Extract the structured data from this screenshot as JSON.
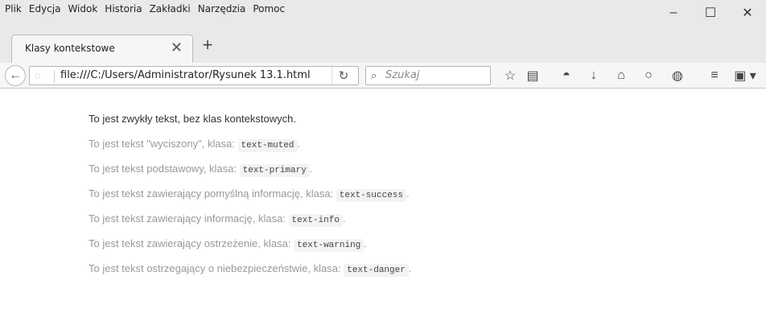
{
  "menu": [
    "Plik",
    "Edycja",
    "Widok",
    "Historia",
    "Zakładki",
    "Narzędzia",
    "Pomoc"
  ],
  "window_controls": {
    "minimize": "–",
    "maximize": "☐",
    "close": "✕"
  },
  "tab": {
    "title": "Klasy kontekstowe",
    "close": "✕"
  },
  "new_tab": "+",
  "url": "file:///C:/Users/Administrator/Rysunek 13.1.html",
  "reload": "↻",
  "search": {
    "placeholder": "Szukaj"
  },
  "toolbar_icons": [
    "star-icon",
    "reading-list-icon",
    "pocket-icon",
    "download-icon",
    "home-icon",
    "chat-icon",
    "addon-icon",
    "menu-icon",
    "extension-icon"
  ],
  "content": {
    "lines": [
      {
        "text": "To jest zwykły tekst, bez klas kontekstowych.",
        "code": "",
        "suffix": ""
      },
      {
        "text": "To jest tekst \"wyciszony\", klasa: ",
        "code": "text-muted",
        "suffix": "."
      },
      {
        "text": "To jest tekst podstawowy, klasa: ",
        "code": "text-primary",
        "suffix": "."
      },
      {
        "text": "To jest tekst zawierający pomyślną informację, klasa: ",
        "code": "text-success",
        "suffix": "."
      },
      {
        "text": "To jest tekst zawierający informację, klasa: ",
        "code": "text-info",
        "suffix": "."
      },
      {
        "text": "To jest tekst zawierający ostrzeżenie, klasa: ",
        "code": "text-warning",
        "suffix": "."
      },
      {
        "text": "To jest tekst ostrzegający o niebezpieczeństwie, klasa: ",
        "code": "text-danger",
        "suffix": "."
      }
    ]
  }
}
